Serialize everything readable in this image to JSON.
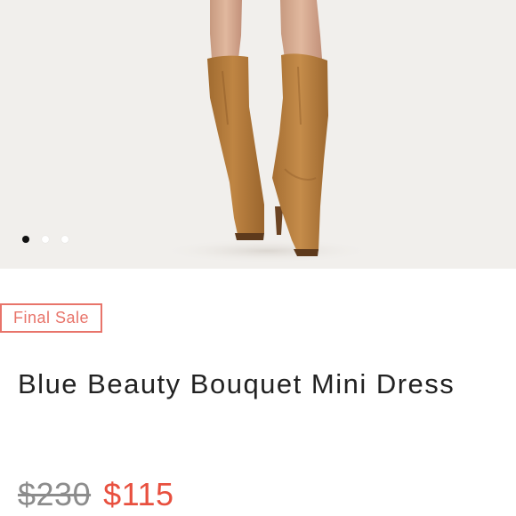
{
  "gallery": {
    "image_alt": "product-photo-knee-high-suede-boots",
    "slide_count": 3,
    "active_slide": 0
  },
  "badge": {
    "label": "Final Sale"
  },
  "product": {
    "title": "Blue Beauty Bouquet Mini Dress"
  },
  "pricing": {
    "original": "$230",
    "sale": "$115"
  },
  "colors": {
    "badge_accent": "#e8746a",
    "sale_price": "#e8503f",
    "original_price": "#8c8c8c",
    "title_text": "#222222",
    "photo_background": "#f1efec",
    "boot_suede": "#b27a3c"
  }
}
